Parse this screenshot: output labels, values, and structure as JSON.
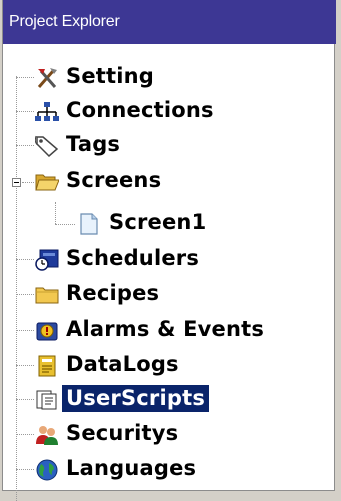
{
  "panel": {
    "title": "Project Explorer"
  },
  "tree": {
    "items": [
      {
        "label": "Setting",
        "icon": "tools-icon"
      },
      {
        "label": "Connections",
        "icon": "network-icon"
      },
      {
        "label": "Tags",
        "icon": "tag-icon"
      },
      {
        "label": "Screens",
        "icon": "folder-open-icon",
        "expanded": true
      },
      {
        "label": "Screen1",
        "icon": "document-icon"
      },
      {
        "label": "Schedulers",
        "icon": "scheduler-icon"
      },
      {
        "label": "Recipes",
        "icon": "folder-icon"
      },
      {
        "label": "Alarms & Events",
        "icon": "alarm-icon"
      },
      {
        "label": "DataLogs",
        "icon": "datalog-icon"
      },
      {
        "label": "UserScripts",
        "icon": "script-icon",
        "selected": true
      },
      {
        "label": "Securitys",
        "icon": "users-icon"
      },
      {
        "label": "Languages",
        "icon": "globe-icon"
      }
    ]
  },
  "colors": {
    "title_bar": "#3d3794",
    "selection": "#0a246a"
  }
}
